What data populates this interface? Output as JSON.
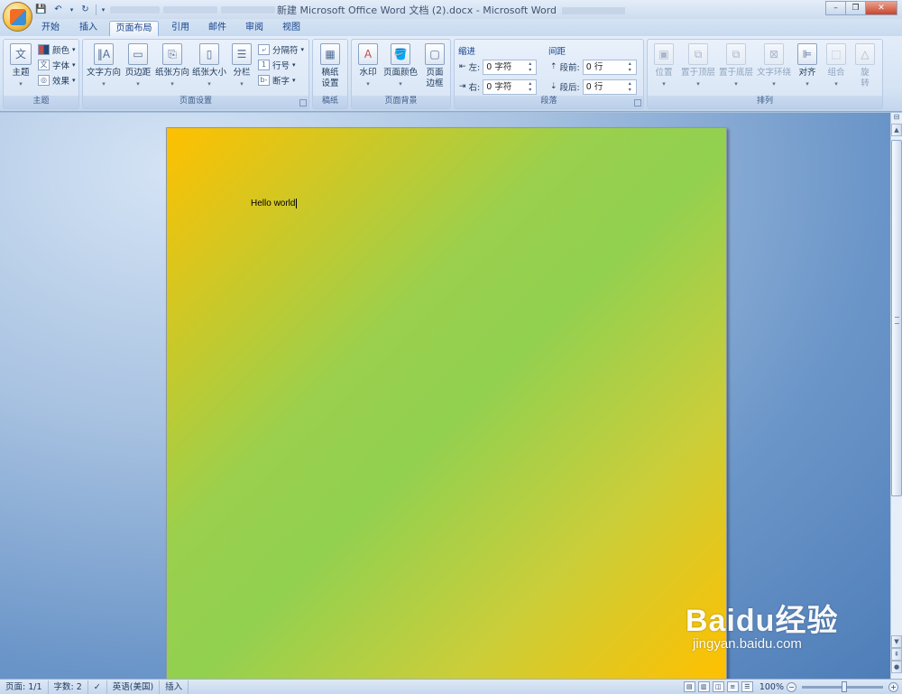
{
  "window": {
    "title": "新建 Microsoft Office Word 文档 (2).docx - Microsoft Word"
  },
  "tabs": [
    {
      "label": "开始"
    },
    {
      "label": "插入"
    },
    {
      "label": "页面布局",
      "active": true
    },
    {
      "label": "引用"
    },
    {
      "label": "邮件"
    },
    {
      "label": "审阅"
    },
    {
      "label": "视图"
    }
  ],
  "ribbon": {
    "theme_group": {
      "label": "主题",
      "themes": "主题",
      "colors": "颜色",
      "fonts": "字体",
      "effects": "效果"
    },
    "page_setup": {
      "label": "页面设置",
      "text_direction": "文字方向",
      "margins": "页边距",
      "orientation": "纸张方向",
      "size": "纸张大小",
      "columns": "分栏",
      "breaks": "分隔符",
      "line_numbers": "行号",
      "hyphenation": "断字"
    },
    "manuscript": {
      "label": "稿纸",
      "setup_line1": "稿纸",
      "setup_line2": "设置"
    },
    "page_background": {
      "label": "页面背景",
      "watermark": "水印",
      "page_color": "页面颜色",
      "borders_line1": "页面",
      "borders_line2": "边框"
    },
    "paragraph": {
      "label": "段落",
      "indent_header": "缩进",
      "spacing_header": "间距",
      "left_label": "左:",
      "left_value": "0 字符",
      "right_label": "右:",
      "right_value": "0 字符",
      "before_label": "段前:",
      "before_value": "0 行",
      "after_label": "段后:",
      "after_value": "0 行"
    },
    "arrange": {
      "label": "排列",
      "position": "位置",
      "bring_front": "置于顶层",
      "send_back": "置于底层",
      "text_wrap": "文字环绕",
      "align": "对齐",
      "group": "组合",
      "rotate_line1": "旋",
      "rotate_line2": "转"
    }
  },
  "document": {
    "text": "Hello world",
    "page_gradient": [
      "#ffc000",
      "#92d050",
      "#ffc000"
    ]
  },
  "statusbar": {
    "page": "页面: 1/1",
    "words": "字数: 2",
    "language": "英语(美国)",
    "mode": "插入",
    "zoom": "100%"
  },
  "watermark": {
    "brand": "Baidu经验",
    "url": "jingyan.baidu.com"
  }
}
